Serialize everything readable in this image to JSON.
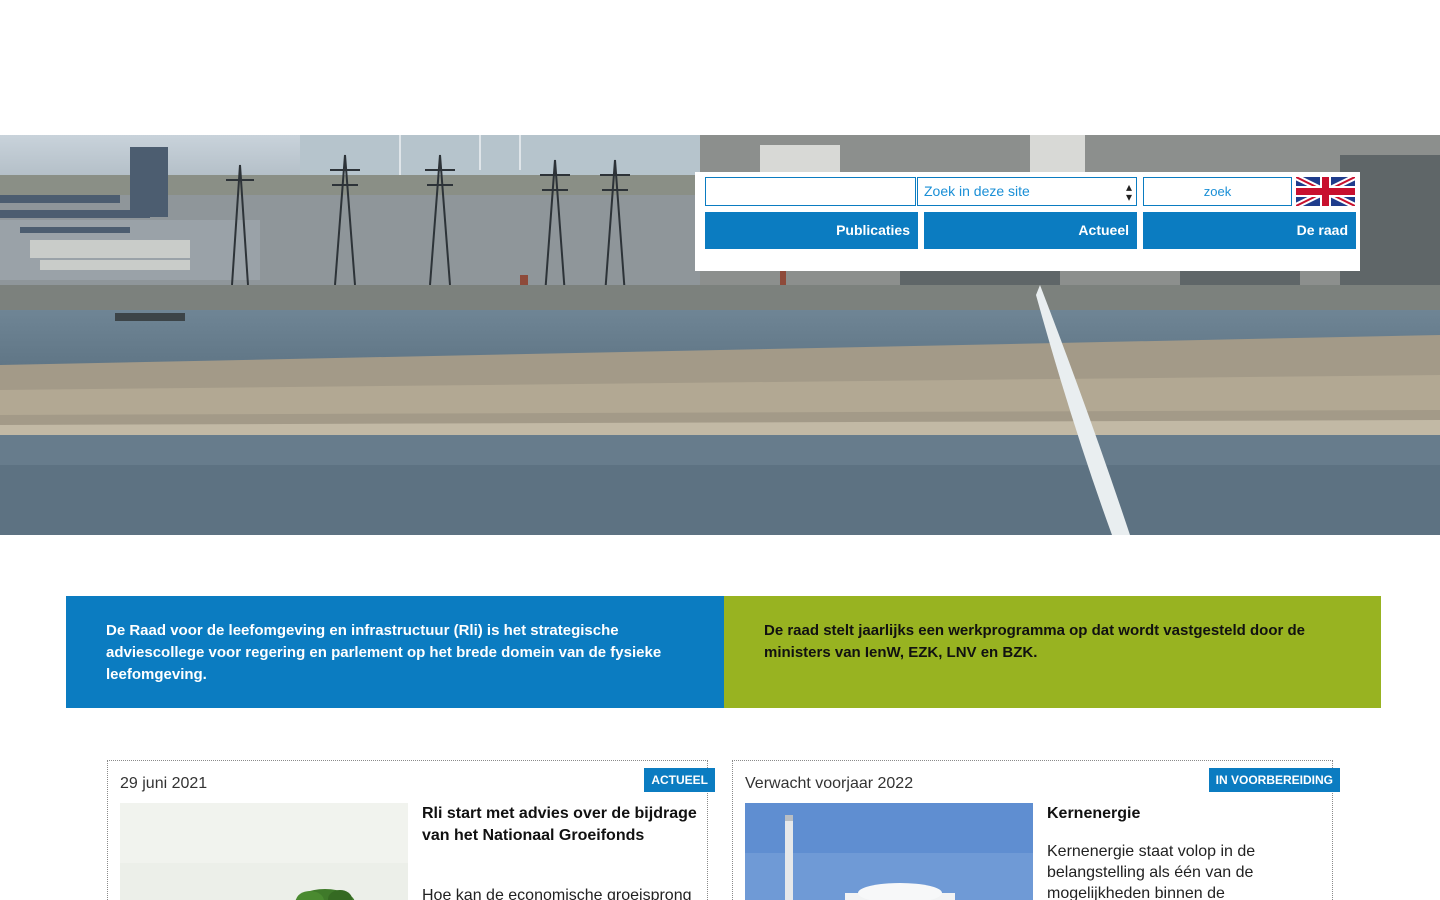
{
  "search": {
    "input_value": "",
    "scope_label": "Zoek in deze site",
    "scope_value": "",
    "button_label": "zoek"
  },
  "language": {
    "flag_icon": "uk-flag-icon"
  },
  "nav": {
    "items": [
      {
        "label": "Publicaties"
      },
      {
        "label": "Actueel"
      },
      {
        "label": "De raad"
      }
    ]
  },
  "intro": {
    "left_text": "De Raad voor de leefomgeving en infrastructuur (Rli) is het strategische adviescollege voor regering en parlement op het brede domein van de fysieke leefomgeving.",
    "right_text": "De raad stelt jaarlijks een werkprogramma op dat wordt vastgesteld door de ministers van IenW, EZK, LNV en BZK."
  },
  "cards": [
    {
      "date": "29 juni 2021",
      "tag": "ACTUEEL",
      "title": "Rli start met advies over de bijdrage van het Nationaal Groeifonds",
      "text": "Hoe kan de economische groeisprong"
    },
    {
      "date": "Verwacht voorjaar 2022",
      "tag": "IN VOORBEREIDING",
      "title": "Kernenergie",
      "text": "Kernenergie staat volop in de belangstelling als één van de mogelijkheden binnen de"
    }
  ],
  "colors": {
    "primary_blue": "#0b7cc1",
    "accent_green": "#98b321"
  }
}
